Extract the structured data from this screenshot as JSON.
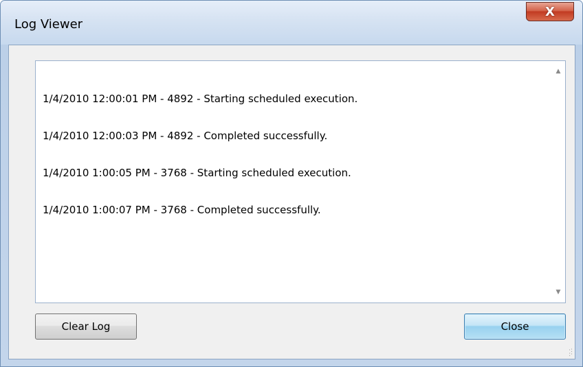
{
  "window": {
    "title": "Log Viewer",
    "close_glyph": "X"
  },
  "log": {
    "lines": [
      "1/4/2010 12:00:01 PM - 4892 - Starting scheduled execution.",
      "1/4/2010 12:00:03 PM - 4892 - Completed successfully.",
      "1/4/2010 1:00:05 PM - 3768 - Starting scheduled execution.",
      "1/4/2010 1:00:07 PM - 3768 - Completed successfully."
    ]
  },
  "buttons": {
    "clear_log": "Clear Log",
    "close": "Close"
  },
  "icons": {
    "scroll_up": "chevron-up-icon",
    "scroll_down": "chevron-down-icon",
    "window_close": "close-icon",
    "resize_grip": "resize-grip-icon"
  },
  "colors": {
    "titlebar": "#d5e2f2",
    "close_button": "#c23b22",
    "default_button": "#98d1ef"
  }
}
